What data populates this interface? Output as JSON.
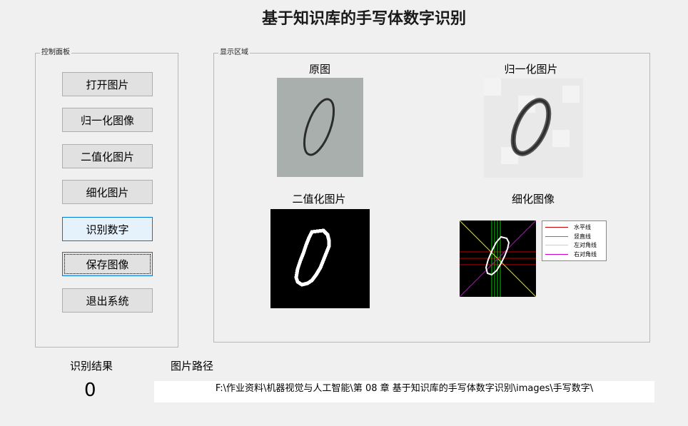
{
  "app": {
    "title": "基于知识库的手写体数字识别"
  },
  "control_panel": {
    "legend": "控制面板",
    "buttons": [
      {
        "label": "打开图片"
      },
      {
        "label": "归一化图像"
      },
      {
        "label": "二值化图片"
      },
      {
        "label": "细化图片"
      },
      {
        "label": "识别数字"
      },
      {
        "label": "保存图像"
      },
      {
        "label": "退出系统"
      }
    ]
  },
  "display_area": {
    "legend": "显示区域",
    "original": {
      "label": "原图"
    },
    "normalized": {
      "label": "归一化图片"
    },
    "binary": {
      "label": "二值化图片"
    },
    "thinned": {
      "label": "细化图像"
    },
    "line_legend": [
      {
        "label": "水平线",
        "color": "#cc0000"
      },
      {
        "label": "竖直线",
        "color": "#00cc00"
      },
      {
        "label": "左对角线",
        "color": "#e6e600"
      },
      {
        "label": "右对角线",
        "color": "#cc00cc"
      }
    ]
  },
  "result": {
    "label": "识别结果",
    "value": "0"
  },
  "path": {
    "label": "图片路径",
    "value": "F:\\作业资料\\机器视觉与人工智能\\第 08 章 基于知识库的手写体数字识别\\images\\手写数字\\"
  }
}
